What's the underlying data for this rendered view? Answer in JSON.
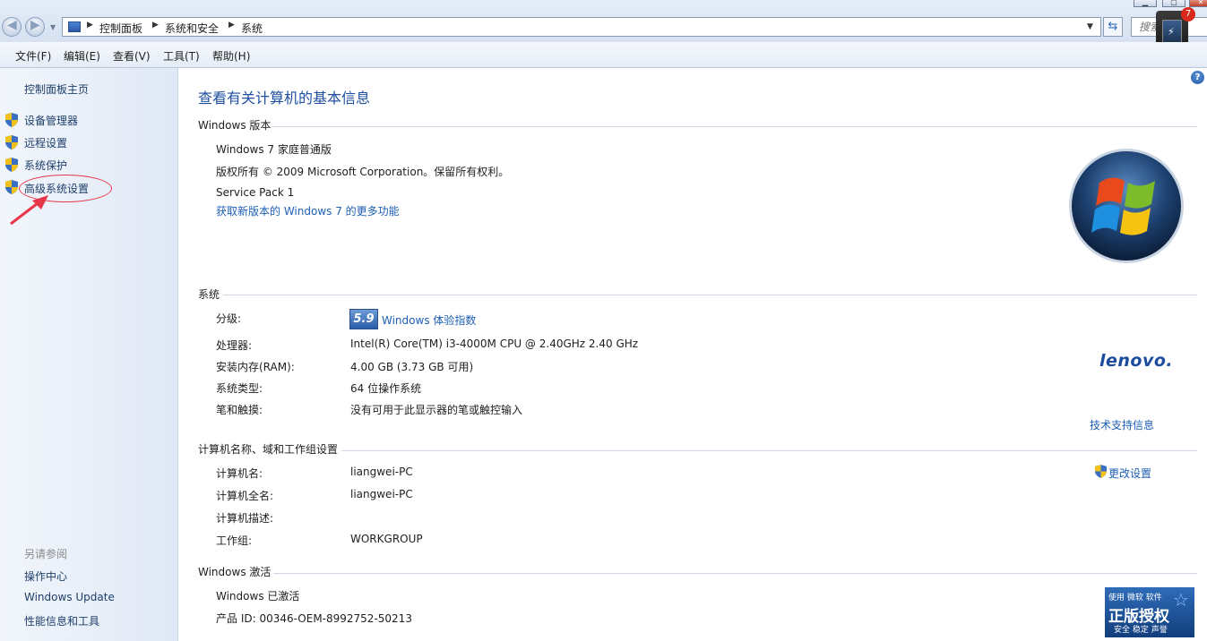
{
  "address_bar": {
    "crumbs": [
      "控制面板",
      "系统和安全",
      "系统"
    ],
    "search_placeholder": "搜索"
  },
  "window_controls": {
    "minimize": "▁",
    "maximize": "▢",
    "close": "✕"
  },
  "notification": {
    "badge_count": "7"
  },
  "menu": {
    "items": [
      "文件(F)",
      "编辑(E)",
      "查看(V)",
      "工具(T)",
      "帮助(H)"
    ]
  },
  "sidebar": {
    "home": "控制面板主页",
    "tasks": [
      "设备管理器",
      "远程设置",
      "系统保护",
      "高级系统设置"
    ],
    "see_also_heading": "另请参阅",
    "see_also": [
      "操作中心",
      "Windows Update",
      "性能信息和工具"
    ]
  },
  "main": {
    "title": "查看有关计算机的基本信息",
    "help_icon": "?",
    "edition": {
      "heading": "Windows 版本",
      "name": "Windows 7 家庭普通版",
      "copyright": "版权所有 © 2009 Microsoft Corporation。保留所有权利。",
      "service_pack": "Service Pack 1",
      "more_features_link": "获取新版本的 Windows 7 的更多功能"
    },
    "system": {
      "heading": "系统",
      "rating_label": "分级:",
      "rating_score": "5.9",
      "rating_link": "Windows 体验指数",
      "processor_label": "处理器:",
      "processor_value": "Intel(R) Core(TM) i3-4000M CPU @ 2.40GHz   2.40 GHz",
      "ram_label": "安装内存(RAM):",
      "ram_value": "4.00 GB (3.73 GB 可用)",
      "type_label": "系统类型:",
      "type_value": "64 位操作系统",
      "pen_label": "笔和触摸:",
      "pen_value": "没有可用于此显示器的笔或触控输入",
      "oem_logo": "lenovo.",
      "support_link": "技术支持信息"
    },
    "computer": {
      "heading": "计算机名称、域和工作组设置",
      "name_label": "计算机名:",
      "name_value": "liangwei-PC",
      "fullname_label": "计算机全名:",
      "fullname_value": "liangwei-PC",
      "desc_label": "计算机描述:",
      "workgroup_label": "工作组:",
      "workgroup_value": "WORKGROUP",
      "change_link": "更改设置"
    },
    "activation": {
      "heading": "Windows 激活",
      "status": "Windows 已激活",
      "product_id": "产品 ID: 00346-OEM-8992752-50213",
      "badge_top": "使用 微软 软件",
      "badge_main": "正版授权",
      "badge_bottom": "安全 稳定 声誉"
    }
  },
  "colors": {
    "link": "#1d5fb4",
    "title": "#1e4fa0",
    "annotation": "#e8374b"
  }
}
